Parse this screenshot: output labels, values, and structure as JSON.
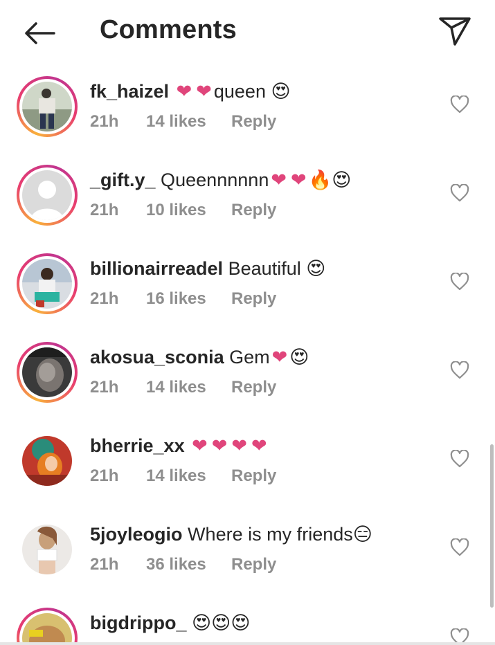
{
  "header": {
    "title": "Comments",
    "back_icon": "arrow-left-icon",
    "send_icon": "paper-plane-icon"
  },
  "colors": {
    "heart": "#e0457b",
    "meta": "#8e8e8e",
    "text": "#262626",
    "ring_start": "#f9b13c",
    "ring_end": "#c1358f"
  },
  "comments": [
    {
      "username": "fk_haizel",
      "text": "❤❤queen 😍",
      "time": "21h",
      "likes": "14 likes",
      "reply": "Reply",
      "has_story_ring": true
    },
    {
      "username": "_gift.y_",
      "text": "Queennnnnn❤❤🔥😍",
      "time": "21h",
      "likes": "10 likes",
      "reply": "Reply",
      "has_story_ring": true
    },
    {
      "username": "billionairreadel",
      "text": "Beautiful 😍",
      "time": "21h",
      "likes": "16 likes",
      "reply": "Reply",
      "has_story_ring": true
    },
    {
      "username": "akosua_sconia",
      "text": "Gem❤😍",
      "time": "21h",
      "likes": "14 likes",
      "reply": "Reply",
      "has_story_ring": true
    },
    {
      "username": "bherrie_xx",
      "text": "❤❤❤❤",
      "time": "21h",
      "likes": "14 likes",
      "reply": "Reply",
      "has_story_ring": false
    },
    {
      "username": "5joyleogio",
      "text": "Where is my friends😑",
      "time": "21h",
      "likes": "36 likes",
      "reply": "Reply",
      "has_story_ring": false
    },
    {
      "username": "bigdrippo_",
      "text": "😍😍😍",
      "has_story_ring": true
    }
  ]
}
